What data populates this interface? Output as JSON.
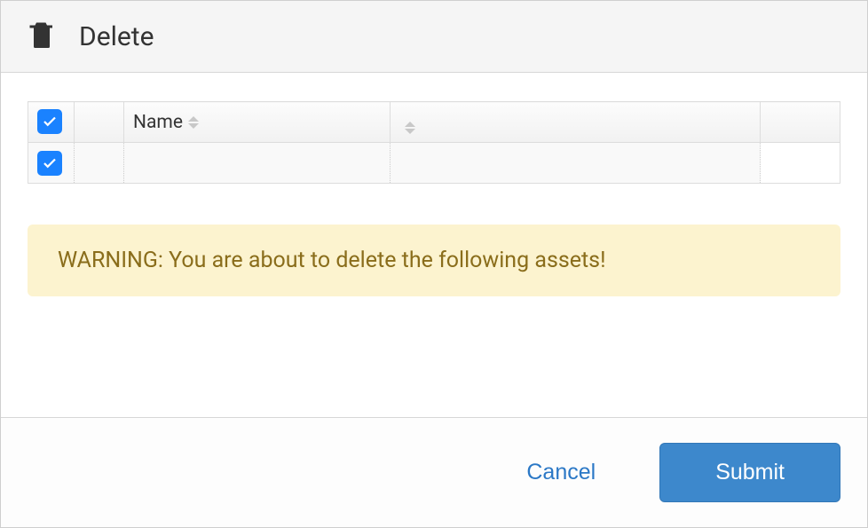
{
  "header": {
    "title": "Delete"
  },
  "table": {
    "columns": {
      "name": "Name"
    },
    "rows": [
      {
        "checked": true
      }
    ],
    "header_checked": true
  },
  "warning": "WARNING: You are about to delete the following assets!",
  "footer": {
    "cancel": "Cancel",
    "submit": "Submit"
  }
}
